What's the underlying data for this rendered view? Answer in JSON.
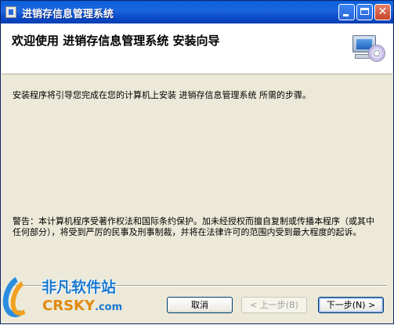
{
  "window": {
    "title": "进销存信息管理系统",
    "controls": {
      "minimize": "minimize",
      "maximize": "maximize",
      "close": "✕"
    }
  },
  "header": {
    "heading": "欢迎使用 进销存信息管理系统 安装向导",
    "icon": "computer-cd-icon"
  },
  "content": {
    "intro": "安装程序将引导您完成在您的计算机上安装 进销存信息管理系统 所需的步骤。",
    "warning": "警告：本计算机程序受著作权法和国际条约保护。加未经授权而擅自复制或传播本程序（或其中任何部分），将受到严厉的民事及刑事制裁，并将在法律许可的范围内受到最大程度的起诉。"
  },
  "buttons": {
    "cancel": "取消",
    "back": "< 上一步(B)",
    "next": "下一步(N) >"
  },
  "watermark": {
    "cn": "非凡软件站",
    "en": "CRSKY",
    "domain": ".com"
  },
  "colors": {
    "titlebar": "#0a5fd8",
    "dialog_bg": "#ece9d8",
    "header_bg": "#ffffff"
  }
}
